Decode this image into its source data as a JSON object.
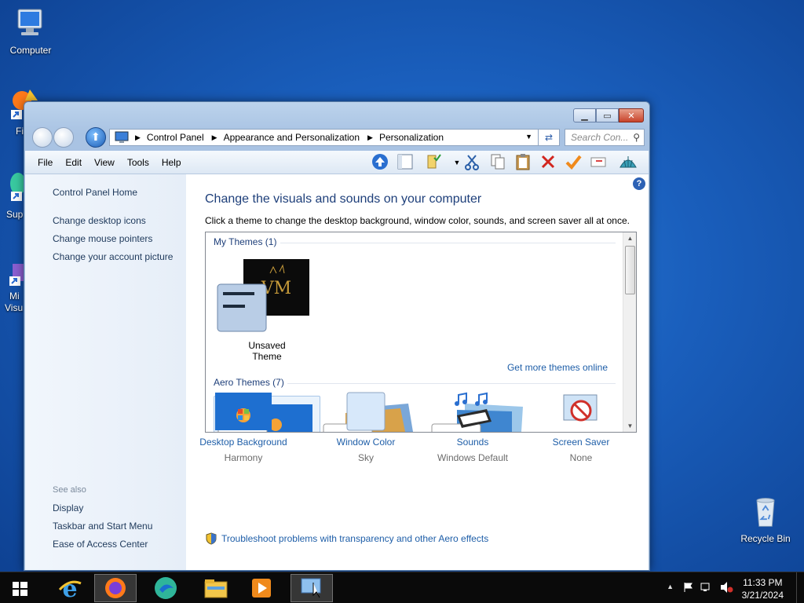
{
  "desktop": {
    "icons": {
      "computer": "Computer",
      "recycle_bin": "Recycle Bin",
      "partial_1": "Fi",
      "partial_2": "Sup",
      "partial_3a": "Mi",
      "partial_3b": "Visu"
    }
  },
  "window": {
    "breadcrumb": [
      "Control Panel",
      "Appearance and Personalization",
      "Personalization"
    ],
    "search_placeholder": "Search Con...",
    "menu": [
      "File",
      "Edit",
      "View",
      "Tools",
      "Help"
    ]
  },
  "sidebar": {
    "home": "Control Panel Home",
    "links": [
      "Change desktop icons",
      "Change mouse pointers",
      "Change your account picture"
    ],
    "see_also_label": "See also",
    "see_also": [
      "Display",
      "Taskbar and Start Menu",
      "Ease of Access Center"
    ]
  },
  "main": {
    "title": "Change the visuals and sounds on your computer",
    "subtitle": "Click a theme to change the desktop background, window color, sounds, and screen saver all at once.",
    "my_themes_header": "My Themes (1)",
    "unsaved_theme_label": "Unsaved Theme",
    "get_more_link": "Get more themes online",
    "aero_themes_header": "Aero Themes (7)",
    "settings": [
      {
        "link": "Desktop Background",
        "value": "Harmony"
      },
      {
        "link": "Window Color",
        "value": "Sky"
      },
      {
        "link": "Sounds",
        "value": "Windows Default"
      },
      {
        "link": "Screen Saver",
        "value": "None"
      }
    ],
    "troubleshoot_link": "Troubleshoot problems with transparency and other Aero effects"
  },
  "taskbar": {
    "time": "11:33 PM",
    "date": "3/21/2024"
  },
  "colors": {
    "accent_link": "#1e5ea8",
    "title_blue": "#1e3f7a",
    "desktop_blue": "#1a5fbd"
  }
}
